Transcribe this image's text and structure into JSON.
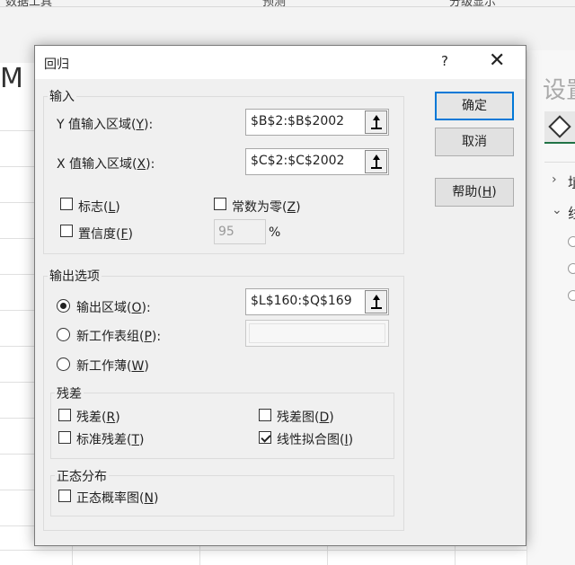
{
  "background": {
    "ribbon_labels": [
      "数据工具",
      "预测",
      "分级显示"
    ],
    "column_letter": "M",
    "pane_title": "设置",
    "pane_items": [
      "埴",
      "线"
    ]
  },
  "dialog": {
    "title": "回归",
    "help_glyph": "?",
    "close_glyph": "✕",
    "input_group": {
      "label": "输入",
      "y_label_prefix": "Y 值输入区域(",
      "y_label_key": "Y",
      "y_label_suffix": "):",
      "y_value": "$B$2:$B$2002",
      "x_label_prefix": "X 值输入区域(",
      "x_label_key": "X",
      "x_label_suffix": "):",
      "x_value": "$C$2:$C$2002",
      "labels_prefix": "标志(",
      "labels_key": "L",
      "labels_suffix": ")",
      "labels_checked": false,
      "const_zero_prefix": "常数为零(",
      "const_zero_key": "Z",
      "const_zero_suffix": ")",
      "const_zero_checked": false,
      "confidence_prefix": "置信度(",
      "confidence_key": "F",
      "confidence_suffix": ")",
      "confidence_checked": false,
      "confidence_value": "95",
      "percent_sign": "%"
    },
    "output_group": {
      "label": "输出选项",
      "output_range_prefix": "输出区域(",
      "output_range_key": "O",
      "output_range_suffix": "):",
      "output_range_value": "$L$160:$Q$169",
      "new_sheet_prefix": "新工作表组(",
      "new_sheet_key": "P",
      "new_sheet_suffix": "):",
      "new_sheet_value": "",
      "new_workbook_prefix": "新工作薄(",
      "new_workbook_key": "W",
      "new_workbook_suffix": ")",
      "selected": "output_range"
    },
    "residuals_group": {
      "label": "残差",
      "residuals_prefix": "残差(",
      "residuals_key": "R",
      "residuals_suffix": ")",
      "residuals_checked": false,
      "residual_plots_prefix": "残差图(",
      "residual_plots_key": "D",
      "residual_plots_suffix": ")",
      "residual_plots_checked": false,
      "std_residuals_prefix": "标准残差(",
      "std_residuals_key": "T",
      "std_residuals_suffix": ")",
      "std_residuals_checked": false,
      "line_fit_prefix": "线性拟合图(",
      "line_fit_key": "I",
      "line_fit_suffix": ")",
      "line_fit_checked": true
    },
    "normal_group": {
      "label": "正态分布",
      "normal_plot_prefix": "正态概率图(",
      "normal_plot_key": "N",
      "normal_plot_suffix": ")",
      "normal_plot_checked": false
    },
    "buttons": {
      "ok": "确定",
      "cancel": "取消",
      "help_prefix": "帮助(",
      "help_key": "H",
      "help_suffix": ")"
    }
  }
}
